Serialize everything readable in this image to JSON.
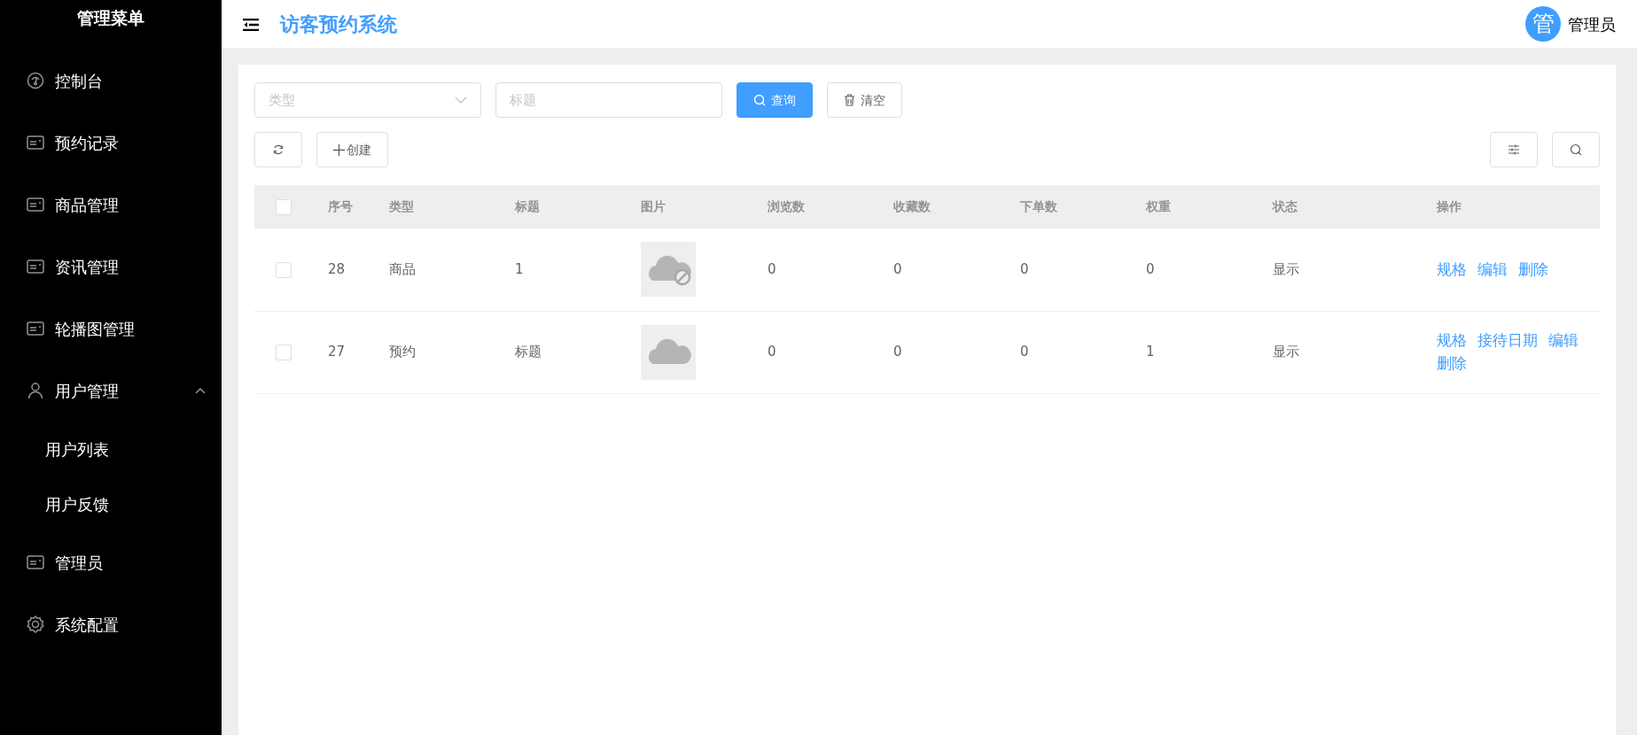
{
  "sidebar": {
    "title": "管理菜单",
    "items": [
      {
        "label": "控制台",
        "kind": "gauge",
        "selected": false
      },
      {
        "label": "预约记录",
        "kind": "card",
        "selected": false
      },
      {
        "label": "商品管理",
        "kind": "card",
        "selected": false
      },
      {
        "label": "资讯管理",
        "kind": "card",
        "selected": false
      },
      {
        "label": "轮播图管理",
        "kind": "card",
        "selected": false
      },
      {
        "label": "用户管理",
        "kind": "person",
        "selected": false,
        "expanded": true,
        "children": [
          {
            "label": "用户列表",
            "selected": false
          },
          {
            "label": "用户反馈",
            "selected": false
          }
        ]
      },
      {
        "label": "管理员",
        "kind": "card",
        "selected": false
      },
      {
        "label": "系统配置",
        "kind": "gear",
        "selected": false
      }
    ]
  },
  "header": {
    "title": "访客预约系统",
    "avatar": "管",
    "user": "管理员"
  },
  "filters": {
    "type_select": {
      "placeholder": "类型"
    },
    "title_input": {
      "placeholder": "标题"
    },
    "search_button": "查询",
    "clear_button": "清空"
  },
  "toolbar": {
    "create_button": "创建"
  },
  "table": {
    "columns": [
      "序号",
      "类型",
      "标题",
      "图片",
      "浏览数",
      "收藏数",
      "下单数",
      "权重",
      "状态",
      "操作"
    ],
    "header_checkbox": {
      "checked": false
    },
    "rows": [
      {
        "checked": false,
        "id": "28",
        "type": "商品",
        "title": "1",
        "image": {
          "kind": "error"
        },
        "views": "0",
        "favorites": "0",
        "orders": "0",
        "weight": "0",
        "status": "显示",
        "actions": [
          "规格",
          "编辑",
          "删除"
        ]
      },
      {
        "checked": false,
        "id": "27",
        "type": "预约",
        "title": "标题",
        "image": {
          "kind": "default"
        },
        "views": "0",
        "favorites": "0",
        "orders": "0",
        "weight": "1",
        "status": "显示",
        "actions": [
          "规格",
          "接待日期",
          "编辑",
          "删除"
        ]
      }
    ]
  }
}
